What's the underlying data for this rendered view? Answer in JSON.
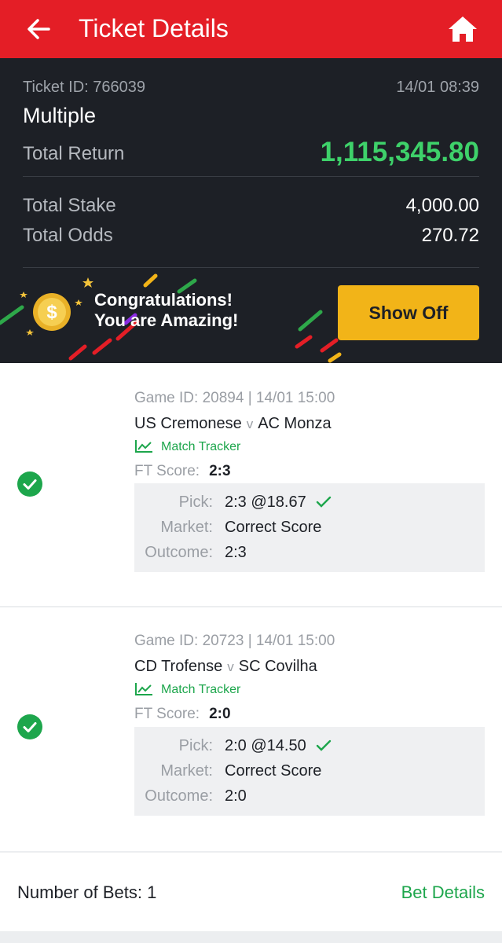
{
  "header": {
    "title": "Ticket Details",
    "back_icon": "arrow-left-icon",
    "home_icon": "home-icon",
    "color": "#e41e26"
  },
  "ticket": {
    "id_text": "Ticket ID: 766039",
    "date": "14/01 08:39",
    "type": "Multiple",
    "total_return_label": "Total Return",
    "total_return": "1,115,345.80",
    "total_stake_label": "Total Stake",
    "total_stake": "4,000.00",
    "total_odds_label": "Total Odds",
    "total_odds": "270.72"
  },
  "banner": {
    "line1": "Congratulations!",
    "line2": "You are Amazing!",
    "button": "Show Off",
    "coin_icon": "coin-icon"
  },
  "bets": [
    {
      "game_line": "Game ID: 20894 | 14/01 15:00",
      "home": "US Cremonese",
      "vs": "v",
      "away": "AC Monza",
      "tracker": "Match Tracker",
      "ft_label": "FT Score:",
      "ft_score": "2:3",
      "pick_label": "Pick:",
      "pick": "2:3 @18.67",
      "market_label": "Market:",
      "market": "Correct Score",
      "outcome_label": "Outcome:",
      "outcome": "2:3",
      "status": "won"
    },
    {
      "game_line": "Game ID: 20723 | 14/01 15:00",
      "home": "CD Trofense",
      "vs": "v",
      "away": "SC Covilha",
      "tracker": "Match Tracker",
      "ft_label": "FT Score:",
      "ft_score": "2:0",
      "pick_label": "Pick:",
      "pick": "2:0 @14.50",
      "market_label": "Market:",
      "market": "Correct Score",
      "outcome_label": "Outcome:",
      "outcome": "2:0",
      "status": "won"
    }
  ],
  "footer": {
    "number_of_bets": "Number of Bets: 1",
    "bet_details": "Bet Details"
  },
  "colors": {
    "accent_green": "#1da64c",
    "return_green": "#3ed16a",
    "button_yellow": "#f2b418",
    "dark_bg": "#1d2026"
  }
}
